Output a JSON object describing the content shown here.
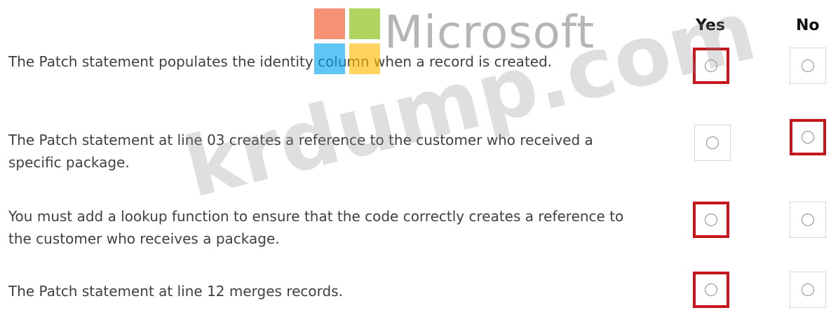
{
  "columns": {
    "yes": "Yes",
    "no": "No"
  },
  "statements": [
    {
      "text": "The Patch statement populates the identity column when a record is created.",
      "selected": "yes"
    },
    {
      "text": "The Patch statement at line 03 creates a reference to the customer who received a specific package.",
      "selected": "no"
    },
    {
      "text": "You must add a lookup function to ensure that the code correctly creates a reference to the customer who receives a package.",
      "selected": "yes"
    },
    {
      "text": "The Patch statement at line 12 merges records.",
      "selected": "yes"
    }
  ],
  "watermark": {
    "brand": "Microsoft",
    "site": "krdump.com",
    "logo_colors": [
      "#f25022",
      "#7fba00",
      "#00a4ef",
      "#ffb900"
    ]
  },
  "colors": {
    "selection_border": "#c4161c"
  }
}
